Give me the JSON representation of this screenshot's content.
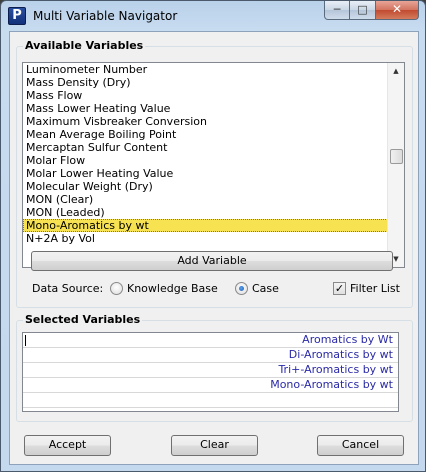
{
  "window": {
    "title": "Multi Variable Navigator",
    "icon_letter": "P",
    "controls": {
      "minimize": "─",
      "maximize": "□",
      "close": "✕"
    }
  },
  "available_variables": {
    "label": "Available Variables",
    "items": [
      "Luminometer Number",
      "Mass Density (Dry)",
      "Mass Flow",
      "Mass Lower Heating Value",
      "Maximum Visbreaker Conversion",
      "Mean Average Boiling Point",
      "Mercaptan Sulfur Content",
      "Molar Flow",
      "Molar Lower Heating Value",
      "Molecular Weight (Dry)",
      "MON (Clear)",
      "MON (Leaded)",
      "Mono-Aromatics by wt",
      "N+2A by Vol"
    ],
    "selected_item": "Mono-Aromatics by wt",
    "scroll_up_icon": "▲",
    "scroll_down_icon": "▼"
  },
  "add_variable_label": "Add Variable",
  "data_source": {
    "label": "Data Source:",
    "options": [
      "Knowledge Base",
      "Case"
    ],
    "selected": "Case",
    "filter_label": "Filter List",
    "filter_checked": true,
    "check_mark": "✓"
  },
  "selected_variables": {
    "label": "Selected Variables",
    "items": [
      "Aromatics by Wt",
      "Di-Aromatics by wt",
      "Tri+-Aromatics by wt",
      "Mono-Aromatics by wt",
      ""
    ]
  },
  "buttons": {
    "accept": "Accept",
    "clear": "Clear",
    "cancel": "Cancel"
  },
  "colors": {
    "selection_highlight": "#f7e352",
    "selected_text": "#2a2aa8",
    "title_gradient": "#b9d1ea"
  }
}
